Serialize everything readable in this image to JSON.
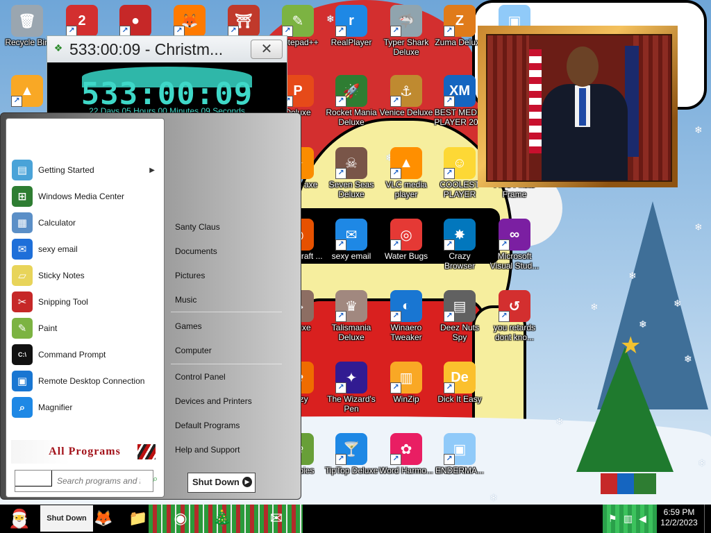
{
  "desktop": {
    "icons": [
      {
        "label": "Recycle Bin",
        "icon": "recycle-bin-icon",
        "color": "#9aa6b0",
        "glyph": "🗑"
      },
      {
        "label": "",
        "icon": "number-2-icon",
        "color": "#d32f2f",
        "glyph": "2"
      },
      {
        "label": "",
        "icon": "red-fuzzy-icon",
        "color": "#c62828",
        "glyph": "●"
      },
      {
        "label": "",
        "icon": "firefox-icon",
        "color": "#ff7a00",
        "glyph": "🦊"
      },
      {
        "label": "",
        "icon": "gate-icon",
        "color": "#c0392b",
        "glyph": "⛩"
      },
      {
        "label": "Notepad++",
        "icon": "notepad-plus-plus-icon",
        "color": "#7cb342",
        "glyph": "✎"
      },
      {
        "label": "RealPlayer",
        "icon": "realplayer-icon",
        "color": "#1e88e5",
        "glyph": "r"
      },
      {
        "label": "Typer Shark Deluxe",
        "icon": "shark-icon",
        "color": "#90a4ae",
        "glyph": "🦈"
      },
      {
        "label": "Zuma Deluxe",
        "icon": "zuma-icon",
        "color": "#e07b1a",
        "glyph": "Z"
      },
      {
        "label": "",
        "icon": "window-icon",
        "color": "#90caf9",
        "glyph": "▣"
      },
      {
        "label": "",
        "icon": "yellow-triangle-icon",
        "color": "#f9a825",
        "glyph": "▲"
      },
      {
        "label": "Deluxe",
        "icon": "game-p-icon",
        "color": "#e64a19",
        "glyph": "P"
      },
      {
        "label": "Rocket Mania Deluxe",
        "icon": "rocket-icon",
        "color": "#2e7d32",
        "glyph": "🚀"
      },
      {
        "label": "Venice Deluxe",
        "icon": "venice-icon",
        "color": "#bf8a30",
        "glyph": "⚓"
      },
      {
        "label": "BEST MEDIA PLAYER 20...",
        "icon": "xm-play-icon",
        "color": "#1565c0",
        "glyph": "XM"
      },
      {
        "label": "Nights axe",
        "icon": "game-icon",
        "color": "#fb8c00",
        "glyph": "✦"
      },
      {
        "label": "Seven Seas Deluxe",
        "icon": "skull-icon",
        "color": "#795548",
        "glyph": "☠"
      },
      {
        "label": "VLC media player",
        "icon": "vlc-icon",
        "color": "#ff8f00",
        "glyph": "▲"
      },
      {
        "label": "COOLEST PLAYER",
        "icon": "smiley-icon",
        "color": "#fdd835",
        "glyph": "☺"
      },
      {
        "label": "Free Photo Frame",
        "icon": "photo-frame-icon",
        "color": "#8d6e63",
        "glyph": "▭"
      },
      {
        "label": "World craft ...",
        "icon": "world-icon",
        "color": "#e65100",
        "glyph": "◉"
      },
      {
        "label": "sexy email",
        "icon": "thunderbird-icon",
        "color": "#1e88e5",
        "glyph": "✉"
      },
      {
        "label": "Water Bugs",
        "icon": "water-bugs-icon",
        "color": "#e53935",
        "glyph": "◎"
      },
      {
        "label": "Crazy Browser",
        "icon": "crazy-browser-icon",
        "color": "#0277bd",
        "glyph": "✸"
      },
      {
        "label": "Microsoft Visual Stud...",
        "icon": "visual-studio-icon",
        "color": "#7b1fa2",
        "glyph": "∞"
      },
      {
        "label": "Deluxe",
        "icon": "game-icon",
        "color": "#8d6e63",
        "glyph": "◆"
      },
      {
        "label": "Talismania Deluxe",
        "icon": "talismania-icon",
        "color": "#a1887f",
        "glyph": "♛"
      },
      {
        "label": "Winaero Tweaker",
        "icon": "winaero-tweaker-icon",
        "color": "#1976d2",
        "glyph": "◐"
      },
      {
        "label": "Deez Nuts Spy",
        "icon": "deez-nuts-spy-icon",
        "color": "#616161",
        "glyph": "▤"
      },
      {
        "label": "you retards dont kno...",
        "icon": "red-circle-icon",
        "color": "#d32f2f",
        "glyph": "↺"
      },
      {
        "label": "renzy",
        "icon": "game-icon",
        "color": "#ef6c00",
        "glyph": "✿"
      },
      {
        "label": "The Wizard's Pen",
        "icon": "wizard-icon",
        "color": "#311b92",
        "glyph": "✦"
      },
      {
        "label": "WinZip",
        "icon": "winzip-icon",
        "color": "#f9a825",
        "glyph": "▥"
      },
      {
        "label": "Dick It Easy",
        "icon": "de-icon",
        "color": "#fbc02d",
        "glyph": "De"
      },
      {
        "label": "s vs bies",
        "icon": "game-icon",
        "color": "#689f38",
        "glyph": "❀"
      },
      {
        "label": "TipTop Deluxe",
        "icon": "cocktail-icon",
        "color": "#1e88e5",
        "glyph": "🍸"
      },
      {
        "label": "Word Harmo...",
        "icon": "flower-icon",
        "color": "#e91e63",
        "glyph": "✿"
      },
      {
        "label": "ENDERMA...",
        "icon": "window-chart-icon",
        "color": "#90caf9",
        "glyph": "▣"
      }
    ]
  },
  "countdown": {
    "title": "533:00:09 - Christm...",
    "big": "533:00:09",
    "small": "22 Days 05 Hours 00 Minutes 09 Seconds",
    "close": "✕"
  },
  "start_menu": {
    "left_items": [
      {
        "label": "Getting Started",
        "icon": "getting-started-icon",
        "color": "#4aa3d8",
        "glyph": "▤",
        "submenu": "▶"
      },
      {
        "label": "Windows Media Center",
        "icon": "windows-media-center-icon",
        "color": "#2e7d32",
        "glyph": "⊞"
      },
      {
        "label": "Calculator",
        "icon": "calculator-icon",
        "color": "#5b8fc7",
        "glyph": "▦"
      },
      {
        "label": "sexy email",
        "icon": "thunderbird-icon",
        "color": "#1e6fd9",
        "glyph": "✉"
      },
      {
        "label": "Sticky Notes",
        "icon": "sticky-notes-icon",
        "color": "#e8d45a",
        "glyph": "▱"
      },
      {
        "label": "Snipping Tool",
        "icon": "snipping-tool-icon",
        "color": "#c62828",
        "glyph": "✂"
      },
      {
        "label": "Paint",
        "icon": "paint-icon",
        "color": "#7cb342",
        "glyph": "✎"
      },
      {
        "label": "Command Prompt",
        "icon": "command-prompt-icon",
        "color": "#111111",
        "glyph": "C:\\"
      },
      {
        "label": "Remote Desktop Connection",
        "icon": "remote-desktop-icon",
        "color": "#1976d2",
        "glyph": "▣"
      },
      {
        "label": "Magnifier",
        "icon": "magnifier-icon",
        "color": "#1e88e5",
        "glyph": "⌕"
      }
    ],
    "all_programs": "All Programs",
    "search_placeholder": "Search programs and files",
    "right_items": [
      "Santy Claus",
      "Documents",
      "Pictures",
      "Music",
      "Games",
      "Computer",
      "Control Panel",
      "Devices and Printers",
      "Default Programs",
      "Help and Support"
    ],
    "shutdown": "Shut Down",
    "shutdown_arrow": "▶"
  },
  "taskbar": {
    "start_glyph": "🎅",
    "pinned": [
      {
        "icon": "shut-down-taskbar-icon",
        "glyph": "Shut Down"
      },
      {
        "icon": "firefox-icon",
        "glyph": "🦊"
      },
      {
        "icon": "file-explorer-icon",
        "glyph": "📁"
      },
      {
        "icon": "chrome-icon",
        "glyph": "◉"
      },
      {
        "icon": "christmas-tree-icon",
        "glyph": "🎄"
      },
      {
        "icon": "thunderbird-icon",
        "glyph": "✉"
      }
    ],
    "clock_time": "6:59 PM",
    "clock_date": "12/2/2023"
  },
  "colors": {
    "countdown_cyan": "#3fd8c8",
    "all_programs_red": "#a3131b"
  }
}
